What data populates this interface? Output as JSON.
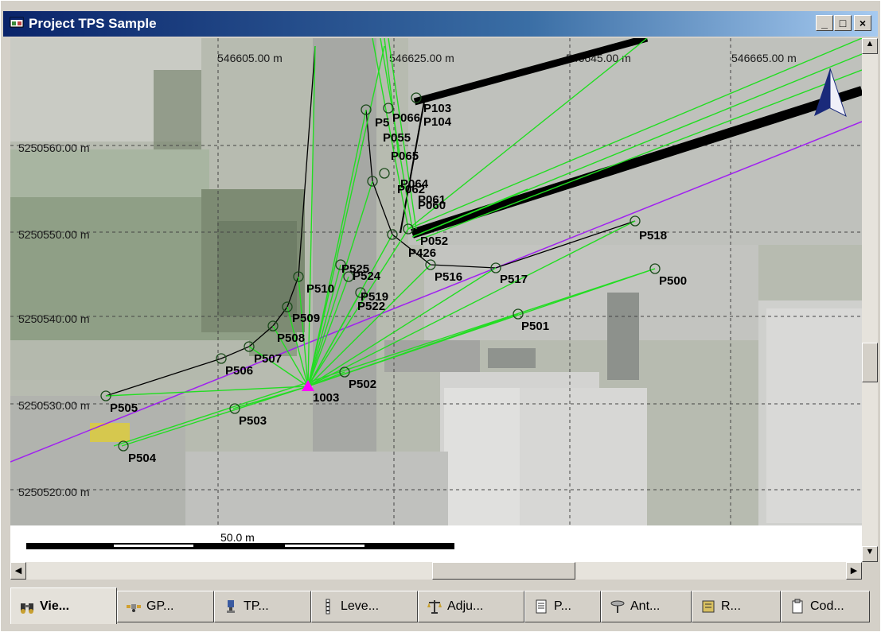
{
  "window": {
    "title": "Project TPS Sample",
    "min": "_",
    "max": "□",
    "close": "×"
  },
  "map": {
    "x_grid": [
      "546605.00 m",
      "546625.00 m",
      "546645.00 m",
      "546665.00 m"
    ],
    "y_grid": [
      "5250560.00 m",
      "5250550.00 m",
      "5250540.00 m",
      "5250530.00 m",
      "5250520.00 m"
    ],
    "points": [
      "P103",
      "P066",
      "P104",
      "P055",
      "P065",
      "P064",
      "P062",
      "P061",
      "P060",
      "P052",
      "P426",
      "P516",
      "P517",
      "P518",
      "P500",
      "P501",
      "P510",
      "P525",
      "P524",
      "P519",
      "P522",
      "P509",
      "P508",
      "P507",
      "P506",
      "P505",
      "P503",
      "P504",
      "P502",
      "1003",
      "P5"
    ],
    "scale_label": "50.0 m"
  },
  "tabs": [
    {
      "label": "Vie...",
      "icon": "binoculars-icon",
      "active": true
    },
    {
      "label": "GP...",
      "icon": "satellite-icon"
    },
    {
      "label": "TP...",
      "icon": "total-station-icon"
    },
    {
      "label": "Leve...",
      "icon": "level-staff-icon"
    },
    {
      "label": "Adju...",
      "icon": "balance-scale-icon"
    },
    {
      "label": "P...",
      "icon": "report-icon"
    },
    {
      "label": "Ant...",
      "icon": "antenna-icon"
    },
    {
      "label": "R...",
      "icon": "book-icon"
    },
    {
      "label": "Cod...",
      "icon": "codelist-icon"
    }
  ]
}
